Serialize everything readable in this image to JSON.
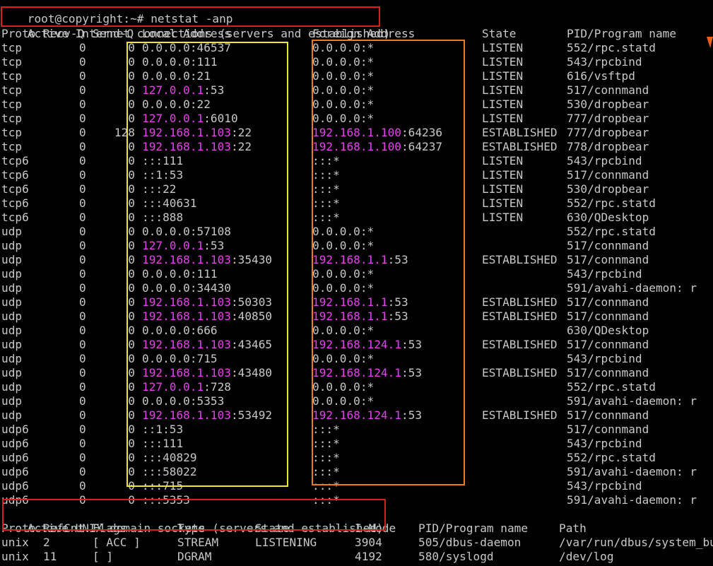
{
  "terminal": {
    "prompt": "root@copyright:~# ",
    "command": "netstat -anp",
    "inet_section_title": "Active Internet connections (servers and established)",
    "inet_headers": {
      "proto": "Proto",
      "recvq": "Recv-Q",
      "sendq": "Send-Q",
      "local": "Local Address",
      "foreign": "Foreign Address",
      "state": "State",
      "pid": "PID/Program name"
    },
    "inet_rows": [
      {
        "proto": "tcp",
        "recvq": "0",
        "sendq": "0",
        "local_host": "0.0.0.0",
        "local_port": ":46537",
        "local_hl": false,
        "foreign_host": "0.0.0.0",
        "foreign_port": ":*",
        "foreign_hl": false,
        "state": "LISTEN",
        "pid": "552/rpc.statd"
      },
      {
        "proto": "tcp",
        "recvq": "0",
        "sendq": "0",
        "local_host": "0.0.0.0",
        "local_port": ":111",
        "local_hl": false,
        "foreign_host": "0.0.0.0",
        "foreign_port": ":*",
        "foreign_hl": false,
        "state": "LISTEN",
        "pid": "543/rpcbind"
      },
      {
        "proto": "tcp",
        "recvq": "0",
        "sendq": "0",
        "local_host": "0.0.0.0",
        "local_port": ":21",
        "local_hl": false,
        "foreign_host": "0.0.0.0",
        "foreign_port": ":*",
        "foreign_hl": false,
        "state": "LISTEN",
        "pid": "616/vsftpd"
      },
      {
        "proto": "tcp",
        "recvq": "0",
        "sendq": "0",
        "local_host": "127.0.0.1",
        "local_port": ":53",
        "local_hl": true,
        "foreign_host": "0.0.0.0",
        "foreign_port": ":*",
        "foreign_hl": false,
        "state": "LISTEN",
        "pid": "517/connmand"
      },
      {
        "proto": "tcp",
        "recvq": "0",
        "sendq": "0",
        "local_host": "0.0.0.0",
        "local_port": ":22",
        "local_hl": false,
        "foreign_host": "0.0.0.0",
        "foreign_port": ":*",
        "foreign_hl": false,
        "state": "LISTEN",
        "pid": "530/dropbear"
      },
      {
        "proto": "tcp",
        "recvq": "0",
        "sendq": "0",
        "local_host": "127.0.0.1",
        "local_port": ":6010",
        "local_hl": true,
        "foreign_host": "0.0.0.0",
        "foreign_port": ":*",
        "foreign_hl": false,
        "state": "LISTEN",
        "pid": "777/dropbear"
      },
      {
        "proto": "tcp",
        "recvq": "0",
        "sendq": "128",
        "local_host": "192.168.1.103",
        "local_port": ":22",
        "local_hl": true,
        "foreign_host": "192.168.1.100",
        "foreign_port": ":64236",
        "foreign_hl": true,
        "state": "ESTABLISHED",
        "pid": "777/dropbear"
      },
      {
        "proto": "tcp",
        "recvq": "0",
        "sendq": "0",
        "local_host": "192.168.1.103",
        "local_port": ":22",
        "local_hl": true,
        "foreign_host": "192.168.1.100",
        "foreign_port": ":64237",
        "foreign_hl": true,
        "state": "ESTABLISHED",
        "pid": "778/dropbear"
      },
      {
        "proto": "tcp6",
        "recvq": "0",
        "sendq": "0",
        "local_host": ":::111",
        "local_port": "",
        "local_hl": false,
        "foreign_host": ":::*",
        "foreign_port": "",
        "foreign_hl": false,
        "state": "LISTEN",
        "pid": "543/rpcbind"
      },
      {
        "proto": "tcp6",
        "recvq": "0",
        "sendq": "0",
        "local_host": "::1:53",
        "local_port": "",
        "local_hl": false,
        "foreign_host": ":::*",
        "foreign_port": "",
        "foreign_hl": false,
        "state": "LISTEN",
        "pid": "517/connmand"
      },
      {
        "proto": "tcp6",
        "recvq": "0",
        "sendq": "0",
        "local_host": ":::22",
        "local_port": "",
        "local_hl": false,
        "foreign_host": ":::*",
        "foreign_port": "",
        "foreign_hl": false,
        "state": "LISTEN",
        "pid": "530/dropbear"
      },
      {
        "proto": "tcp6",
        "recvq": "0",
        "sendq": "0",
        "local_host": ":::40631",
        "local_port": "",
        "local_hl": false,
        "foreign_host": ":::*",
        "foreign_port": "",
        "foreign_hl": false,
        "state": "LISTEN",
        "pid": "552/rpc.statd"
      },
      {
        "proto": "tcp6",
        "recvq": "0",
        "sendq": "0",
        "local_host": ":::888",
        "local_port": "",
        "local_hl": false,
        "foreign_host": ":::*",
        "foreign_port": "",
        "foreign_hl": false,
        "state": "LISTEN",
        "pid": "630/QDesktop"
      },
      {
        "proto": "udp",
        "recvq": "0",
        "sendq": "0",
        "local_host": "0.0.0.0",
        "local_port": ":57108",
        "local_hl": false,
        "foreign_host": "0.0.0.0",
        "foreign_port": ":*",
        "foreign_hl": false,
        "state": "",
        "pid": "552/rpc.statd"
      },
      {
        "proto": "udp",
        "recvq": "0",
        "sendq": "0",
        "local_host": "127.0.0.1",
        "local_port": ":53",
        "local_hl": true,
        "foreign_host": "0.0.0.0",
        "foreign_port": ":*",
        "foreign_hl": false,
        "state": "",
        "pid": "517/connmand"
      },
      {
        "proto": "udp",
        "recvq": "0",
        "sendq": "0",
        "local_host": "192.168.1.103",
        "local_port": ":35430",
        "local_hl": true,
        "foreign_host": "192.168.1.1",
        "foreign_port": ":53",
        "foreign_hl": true,
        "state": "ESTABLISHED",
        "pid": "517/connmand"
      },
      {
        "proto": "udp",
        "recvq": "0",
        "sendq": "0",
        "local_host": "0.0.0.0",
        "local_port": ":111",
        "local_hl": false,
        "foreign_host": "0.0.0.0",
        "foreign_port": ":*",
        "foreign_hl": false,
        "state": "",
        "pid": "543/rpcbind"
      },
      {
        "proto": "udp",
        "recvq": "0",
        "sendq": "0",
        "local_host": "0.0.0.0",
        "local_port": ":34430",
        "local_hl": false,
        "foreign_host": "0.0.0.0",
        "foreign_port": ":*",
        "foreign_hl": false,
        "state": "",
        "pid": "591/avahi-daemon: r"
      },
      {
        "proto": "udp",
        "recvq": "0",
        "sendq": "0",
        "local_host": "192.168.1.103",
        "local_port": ":50303",
        "local_hl": true,
        "foreign_host": "192.168.1.1",
        "foreign_port": ":53",
        "foreign_hl": true,
        "state": "ESTABLISHED",
        "pid": "517/connmand"
      },
      {
        "proto": "udp",
        "recvq": "0",
        "sendq": "0",
        "local_host": "192.168.1.103",
        "local_port": ":40850",
        "local_hl": true,
        "foreign_host": "192.168.1.1",
        "foreign_port": ":53",
        "foreign_hl": true,
        "state": "ESTABLISHED",
        "pid": "517/connmand"
      },
      {
        "proto": "udp",
        "recvq": "0",
        "sendq": "0",
        "local_host": "0.0.0.0",
        "local_port": ":666",
        "local_hl": false,
        "foreign_host": "0.0.0.0",
        "foreign_port": ":*",
        "foreign_hl": false,
        "state": "",
        "pid": "630/QDesktop"
      },
      {
        "proto": "udp",
        "recvq": "0",
        "sendq": "0",
        "local_host": "192.168.1.103",
        "local_port": ":43465",
        "local_hl": true,
        "foreign_host": "192.168.124.1",
        "foreign_port": ":53",
        "foreign_hl": true,
        "state": "ESTABLISHED",
        "pid": "517/connmand"
      },
      {
        "proto": "udp",
        "recvq": "0",
        "sendq": "0",
        "local_host": "0.0.0.0",
        "local_port": ":715",
        "local_hl": false,
        "foreign_host": "0.0.0.0",
        "foreign_port": ":*",
        "foreign_hl": false,
        "state": "",
        "pid": "543/rpcbind"
      },
      {
        "proto": "udp",
        "recvq": "0",
        "sendq": "0",
        "local_host": "192.168.1.103",
        "local_port": ":43480",
        "local_hl": true,
        "foreign_host": "192.168.124.1",
        "foreign_port": ":53",
        "foreign_hl": true,
        "state": "ESTABLISHED",
        "pid": "517/connmand"
      },
      {
        "proto": "udp",
        "recvq": "0",
        "sendq": "0",
        "local_host": "127.0.0.1",
        "local_port": ":728",
        "local_hl": true,
        "foreign_host": "0.0.0.0",
        "foreign_port": ":*",
        "foreign_hl": false,
        "state": "",
        "pid": "552/rpc.statd"
      },
      {
        "proto": "udp",
        "recvq": "0",
        "sendq": "0",
        "local_host": "0.0.0.0",
        "local_port": ":5353",
        "local_hl": false,
        "foreign_host": "0.0.0.0",
        "foreign_port": ":*",
        "foreign_hl": false,
        "state": "",
        "pid": "591/avahi-daemon: r"
      },
      {
        "proto": "udp",
        "recvq": "0",
        "sendq": "0",
        "local_host": "192.168.1.103",
        "local_port": ":53492",
        "local_hl": true,
        "foreign_host": "192.168.124.1",
        "foreign_port": ":53",
        "foreign_hl": true,
        "state": "ESTABLISHED",
        "pid": "517/connmand"
      },
      {
        "proto": "udp6",
        "recvq": "0",
        "sendq": "0",
        "local_host": "::1:53",
        "local_port": "",
        "local_hl": false,
        "foreign_host": ":::*",
        "foreign_port": "",
        "foreign_hl": false,
        "state": "",
        "pid": "517/connmand"
      },
      {
        "proto": "udp6",
        "recvq": "0",
        "sendq": "0",
        "local_host": ":::111",
        "local_port": "",
        "local_hl": false,
        "foreign_host": ":::*",
        "foreign_port": "",
        "foreign_hl": false,
        "state": "",
        "pid": "543/rpcbind"
      },
      {
        "proto": "udp6",
        "recvq": "0",
        "sendq": "0",
        "local_host": ":::40829",
        "local_port": "",
        "local_hl": false,
        "foreign_host": ":::*",
        "foreign_port": "",
        "foreign_hl": false,
        "state": "",
        "pid": "552/rpc.statd"
      },
      {
        "proto": "udp6",
        "recvq": "0",
        "sendq": "0",
        "local_host": ":::58022",
        "local_port": "",
        "local_hl": false,
        "foreign_host": ":::*",
        "foreign_port": "",
        "foreign_hl": false,
        "state": "",
        "pid": "591/avahi-daemon: r"
      },
      {
        "proto": "udp6",
        "recvq": "0",
        "sendq": "0",
        "local_host": ":::715",
        "local_port": "",
        "local_hl": false,
        "foreign_host": ":::*",
        "foreign_port": "",
        "foreign_hl": false,
        "state": "",
        "pid": "543/rpcbind"
      },
      {
        "proto": "udp6",
        "recvq": "0",
        "sendq": "0",
        "local_host": ":::5353",
        "local_port": "",
        "local_hl": false,
        "foreign_host": ":::*",
        "foreign_port": "",
        "foreign_hl": false,
        "state": "",
        "pid": "591/avahi-daemon: r"
      }
    ],
    "unix_section_title": "Active UNIX domain sockets (servers and established)",
    "unix_headers": {
      "proto": "Proto",
      "refcnt": "RefCnt",
      "flags": "Flags",
      "type": "Type",
      "state": "State",
      "inode": "I-Node",
      "pid": "PID/Program name",
      "path": "Path"
    },
    "unix_rows": [
      {
        "proto": "unix",
        "refcnt": "2",
        "flags": "[ ACC ]",
        "type": "STREAM",
        "state": "LISTENING",
        "inode": "3904",
        "pid": "505/dbus-daemon",
        "path": "/var/run/dbus/system_bus_socket"
      },
      {
        "proto": "unix",
        "refcnt": "11",
        "flags": "[ ]",
        "type": "DGRAM",
        "state": "",
        "inode": "4192",
        "pid": "580/syslogd",
        "path": "/dev/log"
      }
    ]
  },
  "colors": {
    "background": "#000000",
    "text": "#c8c8c8",
    "ip_highlight": "#e83ef0",
    "frame_red": "#d62020",
    "frame_yellow": "#f0e630",
    "frame_orange": "#f07a1e"
  }
}
